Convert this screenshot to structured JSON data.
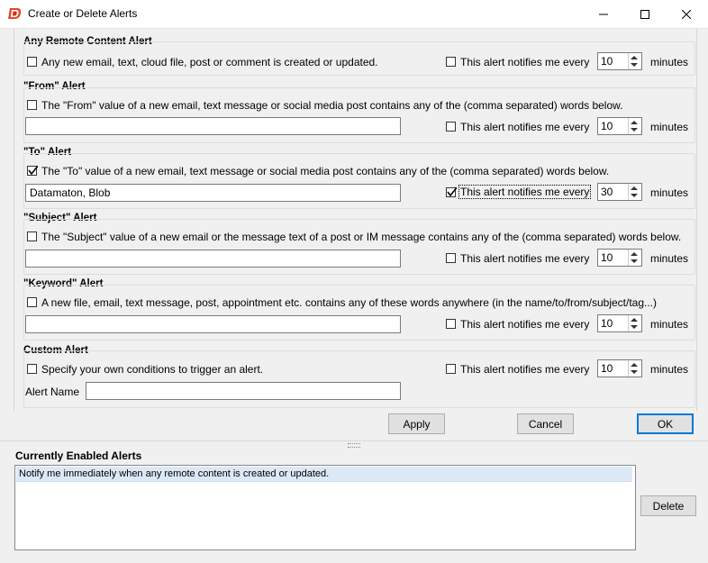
{
  "window": {
    "title": "Create or Delete Alerts",
    "minimize_icon": "minimize-icon",
    "maximize_icon": "maximize-icon",
    "close_icon": "close-icon"
  },
  "sections": [
    {
      "title": "Any Remote Content Alert",
      "checkbox_label": "Any new email, text, cloud file, post or comment is created or updated.",
      "checked": false,
      "input_value": null,
      "notify_label": "This alert notifies me every",
      "notify_checked": false,
      "minutes": "10",
      "minutes_label": "minutes"
    },
    {
      "title": "\"From\" Alert",
      "checkbox_label": "The \"From\" value of a new email, text message or social media post contains any of the (comma separated) words below.",
      "checked": false,
      "input_value": "",
      "notify_label": "This alert notifies me every",
      "notify_checked": false,
      "minutes": "10",
      "minutes_label": "minutes"
    },
    {
      "title": "\"To\" Alert",
      "checkbox_label": "The \"To\" value of a new email, text message or social media post contains any of the (comma separated) words below.",
      "checked": true,
      "input_value": "Datamaton, Blob",
      "notify_label": "This alert notifies me every",
      "notify_checked": true,
      "minutes": "30",
      "minutes_label": "minutes"
    },
    {
      "title": "\"Subject\" Alert",
      "checkbox_label": "The \"Subject\" value of a new email or the message text of a post or IM message contains any of the (comma separated) words below.",
      "checked": false,
      "input_value": "",
      "notify_label": "This alert notifies me every",
      "notify_checked": false,
      "minutes": "10",
      "minutes_label": "minutes"
    },
    {
      "title": "\"Keyword\" Alert",
      "checkbox_label": "A new file, email, text message, post, appointment etc. contains any of these words anywhere (in the name/to/from/subject/tag...)",
      "checked": false,
      "input_value": "",
      "notify_label": "This alert notifies me every",
      "notify_checked": false,
      "minutes": "10",
      "minutes_label": "minutes"
    },
    {
      "title": "Custom Alert",
      "checkbox_label": "Specify your own conditions to trigger an alert.",
      "checked": false,
      "alert_name_label": "Alert Name",
      "input_value": "",
      "notify_label": "This alert notifies me every",
      "notify_checked": false,
      "minutes": "10",
      "minutes_label": "minutes"
    }
  ],
  "buttons": {
    "apply": "Apply",
    "cancel": "Cancel",
    "ok": "OK",
    "delete": "Delete"
  },
  "enabled": {
    "title": "Currently Enabled Alerts",
    "items": [
      "Notify me immediately when any remote content is created or updated."
    ]
  }
}
